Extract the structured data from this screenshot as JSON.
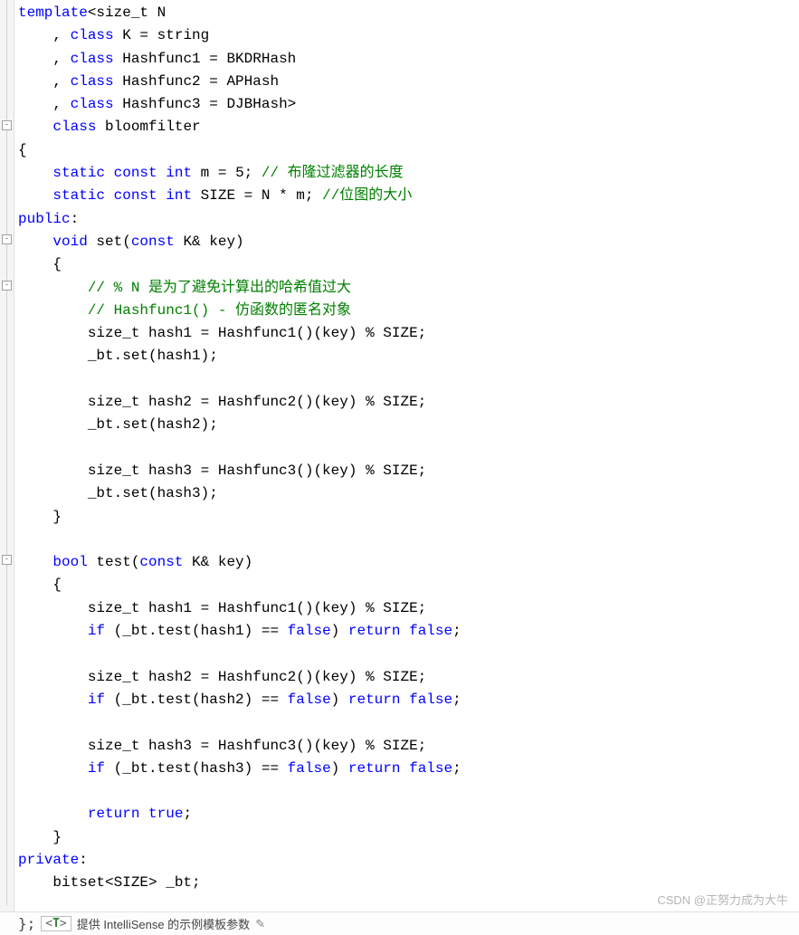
{
  "code_lines": [
    {
      "indent": 0,
      "tokens": [
        [
          "kw",
          "template"
        ],
        [
          "op",
          "<"
        ],
        [
          "ident",
          "size_t"
        ],
        [
          "op",
          " N"
        ]
      ]
    },
    {
      "indent": 1,
      "tokens": [
        [
          "op",
          ", "
        ],
        [
          "kw",
          "class"
        ],
        [
          "op",
          " K = "
        ],
        [
          "ident",
          "string"
        ]
      ]
    },
    {
      "indent": 1,
      "tokens": [
        [
          "op",
          ", "
        ],
        [
          "kw",
          "class"
        ],
        [
          "op",
          " Hashfunc1 = "
        ],
        [
          "ident",
          "BKDRHash"
        ]
      ]
    },
    {
      "indent": 1,
      "tokens": [
        [
          "op",
          ", "
        ],
        [
          "kw",
          "class"
        ],
        [
          "op",
          " Hashfunc2 = "
        ],
        [
          "ident",
          "APHash"
        ]
      ]
    },
    {
      "indent": 1,
      "tokens": [
        [
          "op",
          ", "
        ],
        [
          "kw",
          "class"
        ],
        [
          "op",
          " Hashfunc3 = "
        ],
        [
          "ident",
          "DJBHash"
        ],
        [
          "op",
          ">"
        ]
      ]
    },
    {
      "indent": 1,
      "tokens": [
        [
          "kw",
          "class"
        ],
        [
          "op",
          " bloomfilter"
        ]
      ]
    },
    {
      "indent": 0,
      "tokens": [
        [
          "op",
          "{"
        ]
      ]
    },
    {
      "indent": 1,
      "tokens": [
        [
          "kw",
          "static"
        ],
        [
          "op",
          " "
        ],
        [
          "kw",
          "const"
        ],
        [
          "op",
          " "
        ],
        [
          "kw",
          "int"
        ],
        [
          "op",
          " m = 5; "
        ],
        [
          "comment",
          "// 布隆过滤器的长度"
        ]
      ]
    },
    {
      "indent": 1,
      "tokens": [
        [
          "kw",
          "static"
        ],
        [
          "op",
          " "
        ],
        [
          "kw",
          "const"
        ],
        [
          "op",
          " "
        ],
        [
          "kw",
          "int"
        ],
        [
          "op",
          " SIZE = N * m; "
        ],
        [
          "comment",
          "//位图的大小"
        ]
      ]
    },
    {
      "indent": 0,
      "tokens": [
        [
          "kw",
          "public"
        ],
        [
          "op",
          ":"
        ]
      ]
    },
    {
      "indent": 1,
      "tokens": [
        [
          "kw",
          "void"
        ],
        [
          "op",
          " set("
        ],
        [
          "kw",
          "const"
        ],
        [
          "op",
          " K& key)"
        ]
      ]
    },
    {
      "indent": 1,
      "tokens": [
        [
          "op",
          "{"
        ]
      ]
    },
    {
      "indent": 2,
      "tokens": [
        [
          "comment",
          "// % N 是为了避免计算出的哈希值过大"
        ]
      ]
    },
    {
      "indent": 2,
      "tokens": [
        [
          "comment",
          "// Hashfunc1() - 仿函数的匿名对象"
        ]
      ]
    },
    {
      "indent": 2,
      "tokens": [
        [
          "op",
          "size_t hash1 = Hashfunc1()(key) % SIZE;"
        ]
      ]
    },
    {
      "indent": 2,
      "tokens": [
        [
          "op",
          "_bt.set(hash1);"
        ]
      ]
    },
    {
      "indent": 2,
      "tokens": [
        [
          "op",
          ""
        ]
      ]
    },
    {
      "indent": 2,
      "tokens": [
        [
          "op",
          "size_t hash2 = Hashfunc2()(key) % SIZE;"
        ]
      ]
    },
    {
      "indent": 2,
      "tokens": [
        [
          "op",
          "_bt.set(hash2);"
        ]
      ]
    },
    {
      "indent": 2,
      "tokens": [
        [
          "op",
          ""
        ]
      ]
    },
    {
      "indent": 2,
      "tokens": [
        [
          "op",
          "size_t hash3 = Hashfunc3()(key) % SIZE;"
        ]
      ]
    },
    {
      "indent": 2,
      "tokens": [
        [
          "op",
          "_bt.set(hash3);"
        ]
      ]
    },
    {
      "indent": 1,
      "tokens": [
        [
          "op",
          "}"
        ]
      ]
    },
    {
      "indent": 1,
      "tokens": [
        [
          "op",
          ""
        ]
      ]
    },
    {
      "indent": 1,
      "tokens": [
        [
          "kw",
          "bool"
        ],
        [
          "op",
          " test("
        ],
        [
          "kw",
          "const"
        ],
        [
          "op",
          " K& key)"
        ]
      ]
    },
    {
      "indent": 1,
      "tokens": [
        [
          "op",
          "{"
        ]
      ]
    },
    {
      "indent": 2,
      "tokens": [
        [
          "op",
          "size_t hash1 = Hashfunc1()(key) % SIZE;"
        ]
      ]
    },
    {
      "indent": 2,
      "tokens": [
        [
          "kw",
          "if"
        ],
        [
          "op",
          " (_bt.test(hash1) == "
        ],
        [
          "kw",
          "false"
        ],
        [
          "op",
          ") "
        ],
        [
          "kw",
          "return"
        ],
        [
          "op",
          " "
        ],
        [
          "kw",
          "false"
        ],
        [
          "op",
          ";"
        ]
      ]
    },
    {
      "indent": 2,
      "tokens": [
        [
          "op",
          ""
        ]
      ]
    },
    {
      "indent": 2,
      "tokens": [
        [
          "op",
          "size_t hash2 = Hashfunc2()(key) % SIZE;"
        ]
      ]
    },
    {
      "indent": 2,
      "tokens": [
        [
          "kw",
          "if"
        ],
        [
          "op",
          " (_bt.test(hash2) == "
        ],
        [
          "kw",
          "false"
        ],
        [
          "op",
          ") "
        ],
        [
          "kw",
          "return"
        ],
        [
          "op",
          " "
        ],
        [
          "kw",
          "false"
        ],
        [
          "op",
          ";"
        ]
      ]
    },
    {
      "indent": 2,
      "tokens": [
        [
          "op",
          ""
        ]
      ]
    },
    {
      "indent": 2,
      "tokens": [
        [
          "op",
          "size_t hash3 = Hashfunc3()(key) % SIZE;"
        ]
      ]
    },
    {
      "indent": 2,
      "tokens": [
        [
          "kw",
          "if"
        ],
        [
          "op",
          " (_bt.test(hash3) == "
        ],
        [
          "kw",
          "false"
        ],
        [
          "op",
          ") "
        ],
        [
          "kw",
          "return"
        ],
        [
          "op",
          " "
        ],
        [
          "kw",
          "false"
        ],
        [
          "op",
          ";"
        ]
      ]
    },
    {
      "indent": 2,
      "tokens": [
        [
          "op",
          ""
        ]
      ]
    },
    {
      "indent": 2,
      "tokens": [
        [
          "kw",
          "return"
        ],
        [
          "op",
          " "
        ],
        [
          "kw",
          "true"
        ],
        [
          "op",
          ";"
        ]
      ]
    },
    {
      "indent": 1,
      "tokens": [
        [
          "op",
          "}"
        ]
      ]
    },
    {
      "indent": 0,
      "tokens": [
        [
          "kw",
          "private"
        ],
        [
          "op",
          ":"
        ]
      ]
    },
    {
      "indent": 1,
      "tokens": [
        [
          "op",
          "bitset<SIZE> _bt;"
        ]
      ]
    }
  ],
  "fold_markers": [
    {
      "line": 5,
      "symbol": "-"
    },
    {
      "line": 10,
      "symbol": "-"
    },
    {
      "line": 12,
      "symbol": "-"
    },
    {
      "line": 24,
      "symbol": "-"
    }
  ],
  "bottom_bar": {
    "prefix": "};",
    "badge_open": "<",
    "badge_t": "T",
    "badge_close": ">",
    "hint_text": "提供 IntelliSense 的示例模板参数",
    "pencil": "✎"
  },
  "watermark": "CSDN @正努力成为大牛",
  "indent_unit": "    "
}
